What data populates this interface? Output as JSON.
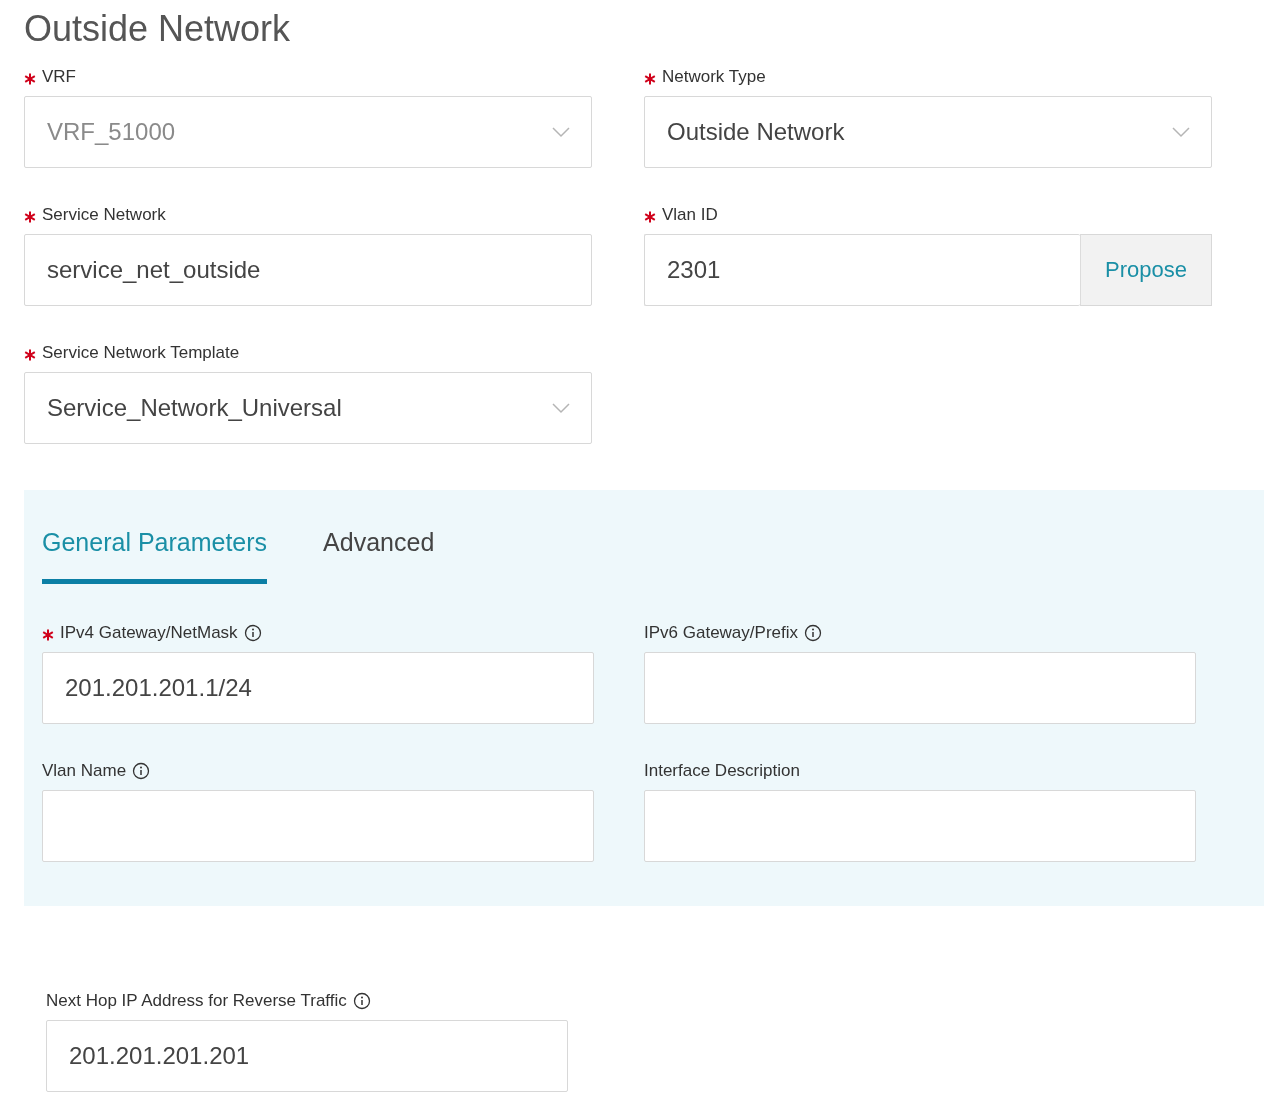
{
  "title": "Outside Network",
  "fields": [
    {
      "label": "VRF",
      "required": true,
      "info": false,
      "kind": "select",
      "value": "VRF_51000",
      "disabled": true
    },
    {
      "label": "Network Type",
      "required": true,
      "info": false,
      "kind": "select",
      "value": "Outside Network",
      "disabled": false
    },
    {
      "label": "Service Network",
      "required": true,
      "info": false,
      "kind": "text",
      "value": "service_net_outside"
    },
    {
      "label": "Vlan ID",
      "required": true,
      "info": false,
      "kind": "text-button",
      "value": "2301",
      "button": "Propose"
    },
    {
      "label": "Service Network Template",
      "required": true,
      "info": false,
      "kind": "select",
      "value": "Service_Network_Universal",
      "disabled": false
    }
  ],
  "tabs": [
    {
      "label": "General Parameters",
      "selected": true
    },
    {
      "label": "Advanced",
      "selected": false
    }
  ],
  "tab_fields": [
    {
      "label": "IPv4 Gateway/NetMask",
      "required": true,
      "info": true,
      "kind": "text",
      "value": "201.201.201.1/24"
    },
    {
      "label": "IPv6 Gateway/Prefix",
      "required": false,
      "info": true,
      "kind": "text"
    },
    {
      "label": "Vlan Name",
      "required": false,
      "info": true,
      "kind": "text"
    },
    {
      "label": "Interface Description",
      "required": false,
      "info": false,
      "kind": "text"
    }
  ],
  "bottom_fields": [
    {
      "label": "Next Hop IP Address for Reverse Traffic",
      "required": false,
      "info": true,
      "kind": "text",
      "value": "201.201.201.201"
    }
  ]
}
